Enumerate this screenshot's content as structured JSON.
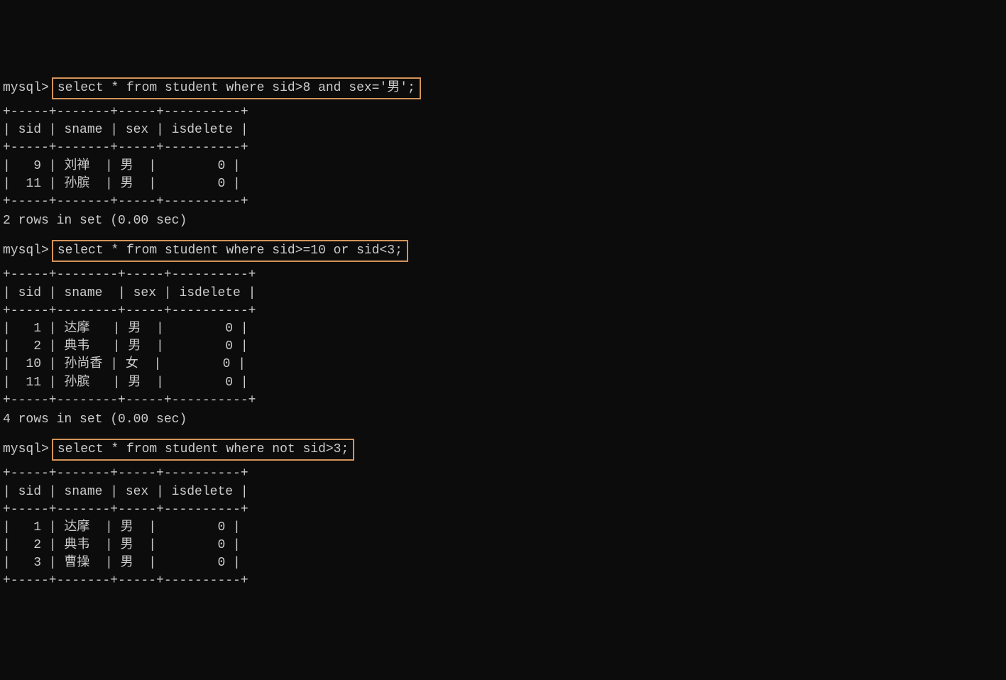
{
  "queries": [
    {
      "prompt": "mysql>",
      "sql": "select * from student where sid>8 and sex='男';",
      "border_top": "+-----+-------+-----+----------+",
      "header": "| sid | sname | sex | isdelete |",
      "border_mid": "+-----+-------+-----+----------+",
      "rows": [
        "|   9 | 刘禅  | 男  |        0 |",
        "|  11 | 孙膑  | 男  |        0 |"
      ],
      "border_bot": "+-----+-------+-----+----------+",
      "footer": "2 rows in set (0.00 sec)"
    },
    {
      "prompt": "mysql>",
      "sql": "select * from student where sid>=10 or sid<3;",
      "border_top": "+-----+--------+-----+----------+",
      "header": "| sid | sname  | sex | isdelete |",
      "border_mid": "+-----+--------+-----+----------+",
      "rows": [
        "|   1 | 达摩   | 男  |        0 |",
        "|   2 | 典韦   | 男  |        0 |",
        "|  10 | 孙尚香 | 女  |        0 |",
        "|  11 | 孙膑   | 男  |        0 |"
      ],
      "border_bot": "+-----+--------+-----+----------+",
      "footer": "4 rows in set (0.00 sec)"
    },
    {
      "prompt": "mysql>",
      "sql": "select * from student where not sid>3;",
      "border_top": "+-----+-------+-----+----------+",
      "header": "| sid | sname | sex | isdelete |",
      "border_mid": "+-----+-------+-----+----------+",
      "rows": [
        "|   1 | 达摩  | 男  |        0 |",
        "|   2 | 典韦  | 男  |        0 |",
        "|   3 | 曹操  | 男  |        0 |"
      ],
      "border_bot": "+-----+-------+-----+----------+",
      "footer": ""
    }
  ]
}
